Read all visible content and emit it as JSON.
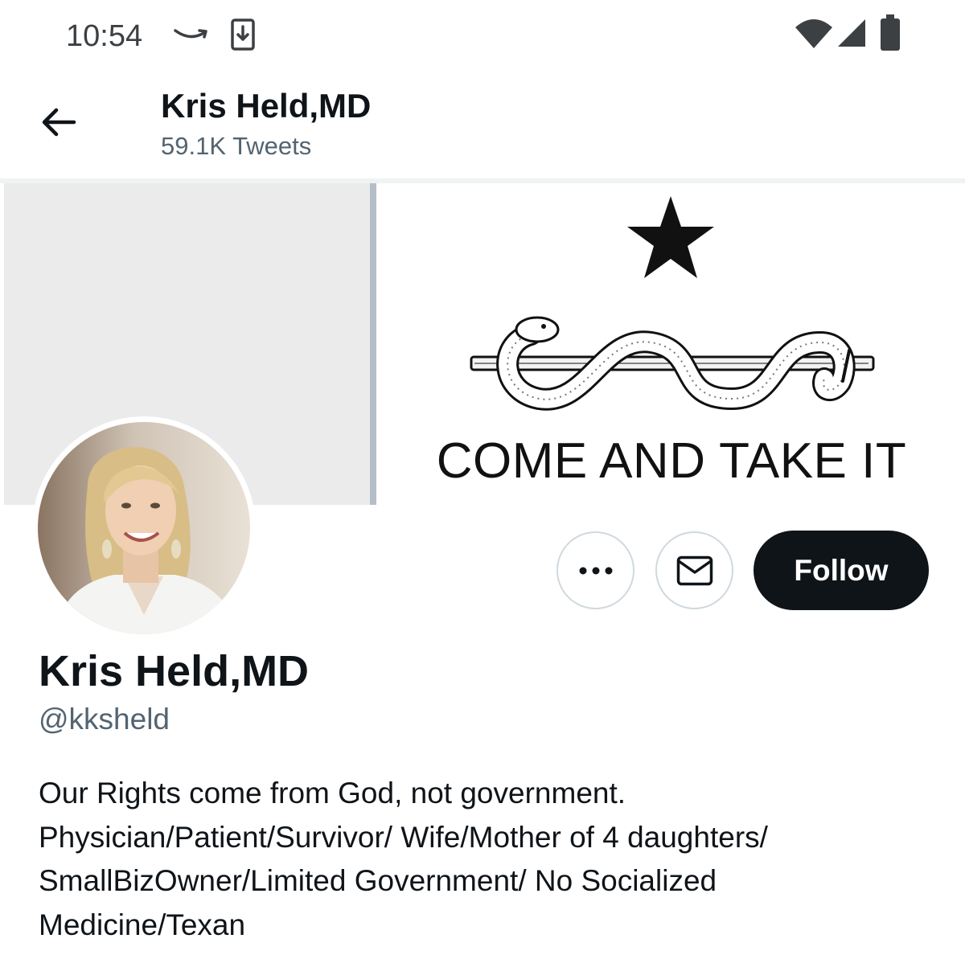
{
  "status_bar": {
    "time": "10:54",
    "icons": [
      "amazon-icon",
      "download-icon",
      "wifi-icon",
      "signal-icon",
      "battery-icon"
    ]
  },
  "header": {
    "title": "Kris Held,MD",
    "tweet_count": "59.1K Tweets"
  },
  "banner": {
    "motto": "COME AND TAKE IT"
  },
  "actions": {
    "more_icon": "more-horizontal-icon",
    "message_icon": "mail-icon",
    "follow_label": "Follow"
  },
  "profile": {
    "name": "Kris Held,MD",
    "handle": "@kksheld",
    "bio_lines": [
      "Our Rights come from God, not government.",
      "Physician/Patient/Survivor/ Wife/Mother of 4 daughters/",
      "SmallBizOwner/Limited Government/ No Socialized",
      "Medicine/Texan"
    ]
  },
  "colors": {
    "text_primary": "#0f1419",
    "text_secondary": "#536471",
    "button_dark": "#0f1419",
    "border": "#cfd9de",
    "banner_gray": "#ebebeb"
  }
}
